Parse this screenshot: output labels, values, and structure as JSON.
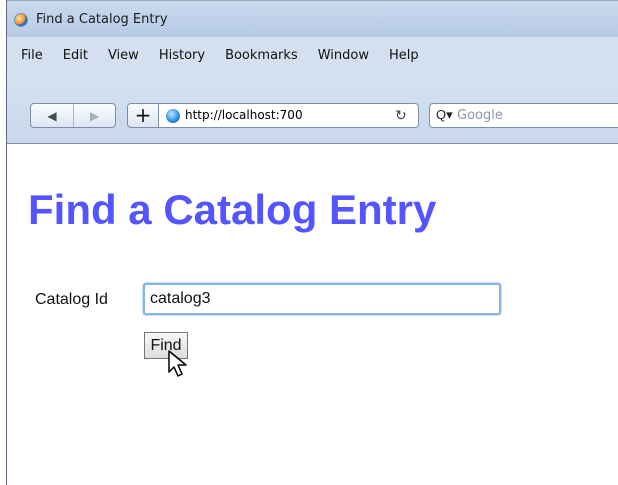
{
  "window": {
    "title": "Find a Catalog Entry"
  },
  "menu": {
    "items": [
      "File",
      "Edit",
      "View",
      "History",
      "Bookmarks",
      "Window",
      "Help"
    ]
  },
  "toolbar": {
    "back_icon": "◀",
    "forward_icon": "▶",
    "new_tab_label": "+",
    "url": "http://localhost:700",
    "reload_icon": "↻",
    "search_icon": "Q▾",
    "search_placeholder": "Google"
  },
  "page": {
    "heading": "Find a Catalog Entry",
    "catalog_label": "Catalog Id",
    "catalog_value": "catalog3",
    "find_button": "Find"
  },
  "colors": {
    "heading": "#5555ff",
    "browser_chrome": "#d4e0ef"
  },
  "icons": {
    "title_icon": "browser-app-icon",
    "site_icon": "globe-icon",
    "pointer": "mouse-pointer-icon"
  }
}
